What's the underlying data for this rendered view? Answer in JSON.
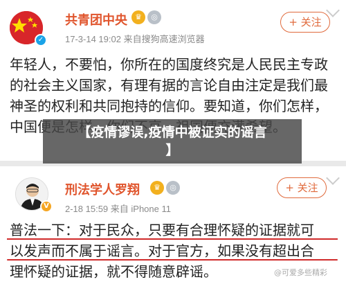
{
  "post1": {
    "name": "共青团中央",
    "meta": "17-3-14 19:02  来自搜狗高速浏览器",
    "follow_label": "+ 关注",
    "text": "年轻人，不要怕，你所在的国度终究是人民民主专政的社会主义国家，有理有据的言论自由注定是我们最神圣的权利和共同抱持的信仰。要知道，你们怎样，中国便是怎样，你们不哀，祖国便充满希望。",
    "icons": [
      "flag-avatar",
      "verified-badge",
      "gold-medal",
      "silver-medal"
    ]
  },
  "overlay": {
    "title_line1": "【疫情谬误,疫情中被证实的谣言",
    "title_line2": "】"
  },
  "post2": {
    "name": "刑法学人罗翔",
    "meta": "2-18 15:59  来自 iPhone 11",
    "follow_label": "+ 关注",
    "text_line1": "普法一下：对于民众，只要有合理怀疑的证据就可",
    "text_line2": "以发声而不属于谣言。对于官方，如果没有超出合",
    "text_line3": "理怀疑的证据，就不得随意辟谣。"
  },
  "watermark": "@可爱多些精彩",
  "colors": {
    "name": "#e0552d",
    "follow": "#e06a3c",
    "underline": "#d02a2a",
    "overlay": "rgba(70,70,70,0.82)"
  }
}
